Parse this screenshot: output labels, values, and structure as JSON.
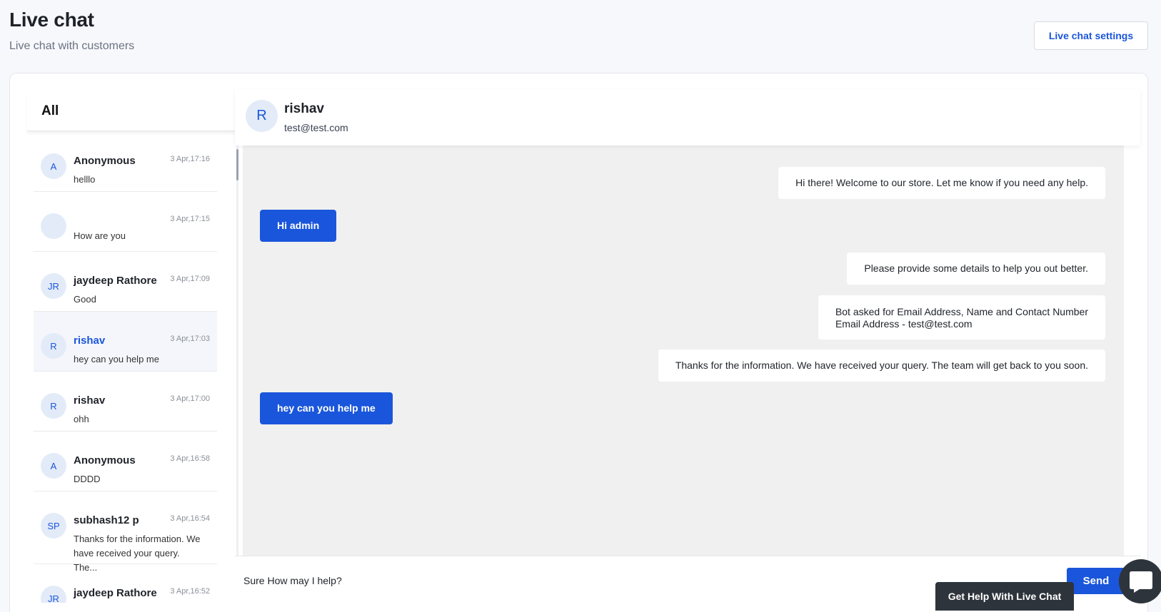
{
  "header": {
    "title": "Live chat",
    "subtitle": "Live chat with customers",
    "settings_label": "Live chat settings"
  },
  "conversations": {
    "filter_label": "All",
    "items": [
      {
        "initials": "A",
        "name": "Anonymous",
        "time": "3 Apr,17:16",
        "preview": "helllo"
      },
      {
        "initials": "",
        "name": "",
        "time": "3 Apr,17:15",
        "preview": "How are you"
      },
      {
        "initials": "JR",
        "name": "jaydeep Rathore",
        "time": "3 Apr,17:09",
        "preview": "Good"
      },
      {
        "initials": "R",
        "name": "rishav",
        "time": "3 Apr,17:03",
        "preview": "hey can you help me"
      },
      {
        "initials": "R",
        "name": "rishav",
        "time": "3 Apr,17:00",
        "preview": "ohh"
      },
      {
        "initials": "A",
        "name": "Anonymous",
        "time": "3 Apr,16:58",
        "preview": "DDDD"
      },
      {
        "initials": "SP",
        "name": "subhash12 p",
        "time": "3 Apr,16:54",
        "preview": "Thanks for the information. We have received your query. The..."
      },
      {
        "initials": "JR",
        "name": "jaydeep Rathore",
        "time": "3 Apr,16:52",
        "preview": ""
      }
    ]
  },
  "chat": {
    "contact_initial": "R",
    "contact_name": "rishav",
    "contact_email": "test@test.com",
    "messages": [
      {
        "from": "bot",
        "text": "Hi there! Welcome to our store. Let me know if you need any help."
      },
      {
        "from": "user",
        "text": "Hi admin"
      },
      {
        "from": "bot",
        "text": "Please provide some details to help you out better."
      },
      {
        "from": "bot",
        "line1": "Bot asked for Email Address, Name and Contact Number",
        "line2": "Email Address - test@test.com"
      },
      {
        "from": "bot",
        "text": "Thanks for the information. We have received your query. The team will get back to you soon."
      },
      {
        "from": "user",
        "text": "hey can you help me"
      }
    ],
    "composer_value": "Sure How may I help?",
    "send_label": "Send"
  },
  "widget": {
    "help_label": "Get Help With Live Chat"
  },
  "colors": {
    "accent": "#1a56db",
    "widget_dark": "#2e343b"
  }
}
